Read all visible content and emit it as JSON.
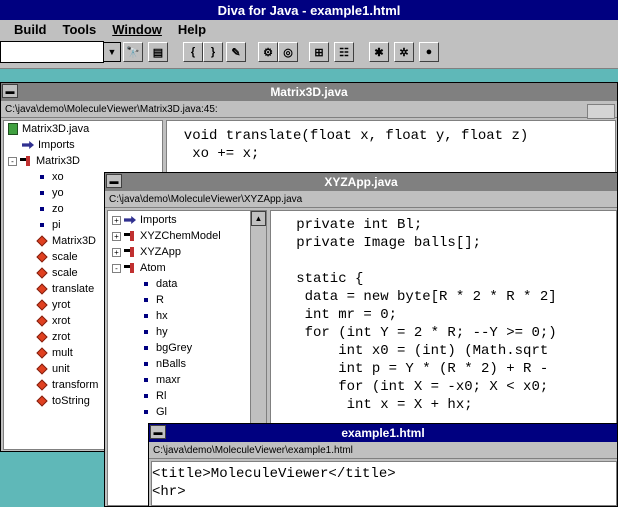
{
  "app": {
    "title": "Diva for Java - example1.html"
  },
  "menu": [
    {
      "label": "Build",
      "underline": false
    },
    {
      "label": "Tools",
      "underline": false
    },
    {
      "label": "Window",
      "underline": true
    },
    {
      "label": "Help",
      "underline": false
    }
  ],
  "toolbar": {
    "combo_value": "",
    "buttons": [
      {
        "icon": "dropdown-arrow-icon",
        "glyph": "▾"
      },
      {
        "icon": "binoculars-icon",
        "glyph": "🔭"
      },
      {
        "icon": "print-icon",
        "glyph": "▤"
      },
      {
        "icon": "open-brace-icon",
        "glyph": "{"
      },
      {
        "icon": "close-brace-icon",
        "glyph": "}"
      },
      {
        "icon": "pen-icon",
        "glyph": "✎"
      },
      {
        "icon": "gear-icon",
        "glyph": "⚙"
      },
      {
        "icon": "globe-icon",
        "glyph": "◎"
      },
      {
        "icon": "hierarchy-icon",
        "glyph": "⊞"
      },
      {
        "icon": "classes-icon",
        "glyph": "☷"
      },
      {
        "icon": "bug-icon",
        "glyph": "✱"
      },
      {
        "icon": "web-icon",
        "glyph": "✲"
      },
      {
        "icon": "bomb-icon",
        "glyph": "●"
      }
    ]
  },
  "matrix_window": {
    "title": "Matrix3D.java",
    "path": "C:\\java\\demo\\MoleculeViewer\\Matrix3D.java:45:",
    "tree": [
      {
        "label": "Matrix3D.java",
        "icon": "file",
        "indent": 0
      },
      {
        "label": "Imports",
        "icon": "import",
        "indent": 1
      },
      {
        "label": "Matrix3D",
        "icon": "class",
        "indent": 0,
        "expander": "-"
      },
      {
        "label": "xo",
        "icon": "dot",
        "indent": 2
      },
      {
        "label": "yo",
        "icon": "dot",
        "indent": 2
      },
      {
        "label": "zo",
        "icon": "dot",
        "indent": 2
      },
      {
        "label": "pi",
        "icon": "dot",
        "indent": 2
      },
      {
        "label": "Matrix3D",
        "icon": "diamond",
        "indent": 2
      },
      {
        "label": "scale",
        "icon": "diamond",
        "indent": 2
      },
      {
        "label": "scale",
        "icon": "diamond",
        "indent": 2
      },
      {
        "label": "translate",
        "icon": "diamond",
        "indent": 2
      },
      {
        "label": "yrot",
        "icon": "diamond",
        "indent": 2
      },
      {
        "label": "xrot",
        "icon": "diamond",
        "indent": 2
      },
      {
        "label": "zrot",
        "icon": "diamond",
        "indent": 2
      },
      {
        "label": "mult",
        "icon": "diamond",
        "indent": 2
      },
      {
        "label": "unit",
        "icon": "diamond",
        "indent": 2
      },
      {
        "label": "transform",
        "icon": "diamond",
        "indent": 2
      },
      {
        "label": "toString",
        "icon": "diamond",
        "indent": 2
      }
    ],
    "code": [
      "  void translate(float x, float y, float z)",
      "   xo += x;"
    ]
  },
  "xyz_window": {
    "title": "XYZApp.java",
    "path": "C:\\java\\demo\\MoleculeViewer\\XYZApp.java",
    "tree": [
      {
        "label": "Imports",
        "icon": "import",
        "indent": 0,
        "expander": "+"
      },
      {
        "label": "XYZChemModel",
        "icon": "class",
        "indent": 0,
        "expander": "+"
      },
      {
        "label": "XYZApp",
        "icon": "class",
        "indent": 0,
        "expander": "+"
      },
      {
        "label": "Atom",
        "icon": "class",
        "indent": 0,
        "expander": "-"
      },
      {
        "label": "data",
        "icon": "dot",
        "indent": 2
      },
      {
        "label": "R",
        "icon": "dot",
        "indent": 2
      },
      {
        "label": "hx",
        "icon": "dot",
        "indent": 2
      },
      {
        "label": "hy",
        "icon": "dot",
        "indent": 2
      },
      {
        "label": "bgGrey",
        "icon": "dot",
        "indent": 2
      },
      {
        "label": "nBalls",
        "icon": "dot",
        "indent": 2
      },
      {
        "label": "maxr",
        "icon": "dot",
        "indent": 2
      },
      {
        "label": "Rl",
        "icon": "dot",
        "indent": 2
      },
      {
        "label": "Gl",
        "icon": "dot",
        "indent": 2
      }
    ],
    "code": [
      "   private int Bl;",
      "   private Image balls[];",
      "",
      "   static {",
      "    data = new byte[R * 2 * R * 2]",
      "    int mr = 0;",
      "    for (int Y = 2 * R; --Y >= 0;)",
      "        int x0 = (int) (Math.sqrt",
      "        int p = Y * (R * 2) + R -",
      "        for (int X = -x0; X < x0;",
      "         int x = X + hx;"
    ]
  },
  "example_window": {
    "title": "example1.html",
    "path": "C:\\java\\demo\\MoleculeViewer\\example1.html",
    "code": [
      "<title>MoleculeViewer</title>",
      "<hr>"
    ]
  }
}
